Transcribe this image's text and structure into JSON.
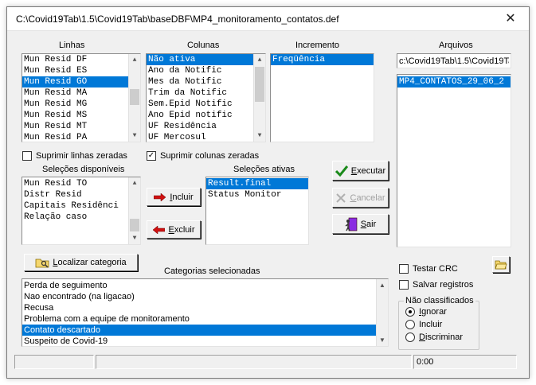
{
  "window": {
    "title": "C:\\Covid19Tab\\1.5\\Covid19Tab\\baseDBF\\MP4_monitoramento_contatos.def",
    "close_glyph": "✕"
  },
  "linhas": {
    "label": "Linhas",
    "items": [
      "Mun Resid DF",
      "Mun Resid ES",
      "Mun Resid GO",
      "Mun Resid MA",
      "Mun Resid MG",
      "Mun Resid MS",
      "Mun Resid MT",
      "Mun Resid PA"
    ],
    "selected_index": 2
  },
  "colunas": {
    "label": "Colunas",
    "items": [
      "Não ativa",
      "Ano da Notific",
      "Mes da Notific",
      "Trim da Notific",
      "Sem.Epid Notific",
      "Ano Epid notific",
      "UF Residência",
      "UF Mercosul"
    ],
    "selected_index": 0
  },
  "incremento": {
    "label": "Incremento",
    "items": [
      "Freqüência"
    ],
    "selected_index": 0
  },
  "arquivos": {
    "label": "Arquivos",
    "path_value": "c:\\Covid19Tab\\1.5\\Covid19Tab",
    "items": [
      "MP4_CONTATOS_29_06_2"
    ],
    "selected_index": 0
  },
  "checks": {
    "suprimir_linhas": {
      "label": "Suprimir linhas zeradas",
      "checked": false
    },
    "suprimir_colunas": {
      "label": "Suprimir colunas zeradas",
      "checked": true
    },
    "testar_crc": {
      "label": "Testar CRC",
      "checked": false
    },
    "salvar_registros": {
      "label": "Salvar registros",
      "checked": false
    }
  },
  "selecoes_disponiveis": {
    "label": "Seleções disponíveis",
    "items": [
      "Mun Resid TO",
      "Distr Resid",
      "Capitais Residênci",
      "Relação caso"
    ]
  },
  "selecoes_ativas": {
    "label": "Seleções ativas",
    "items": [
      "Result.final",
      "Status Monitor"
    ],
    "selected_index": 0
  },
  "buttons": {
    "incluir": {
      "first": "I",
      "rest": "ncluir"
    },
    "excluir": {
      "first": "E",
      "rest": "xcluir"
    },
    "executar": {
      "first": "E",
      "rest": "xecutar"
    },
    "cancelar": {
      "first": "C",
      "rest": "ancelar"
    },
    "sair": {
      "first": "S",
      "rest": "air"
    },
    "localizar": {
      "first": "L",
      "rest": "ocalizar categoria"
    }
  },
  "categorias": {
    "label": "Categorias selecionadas",
    "items": [
      "Perda de seguimento",
      "Nao encontrado (na ligacao)",
      "Recusa",
      "Problema com a equipe de monitoramento",
      "Contato descartado",
      "Suspeito de Covid-19"
    ],
    "selected_index": 4
  },
  "nao_classificados": {
    "label": "Não classificados",
    "options": [
      {
        "first": "I",
        "rest": "gnorar",
        "selected": true
      },
      {
        "first": "",
        "rest": "Incluir",
        "selected": false
      },
      {
        "first": "D",
        "rest": "iscriminar",
        "selected": false
      }
    ]
  },
  "statusbar": {
    "panel1": "",
    "panel2": "",
    "time": "0:00"
  },
  "colors": {
    "selection": "#0078d7",
    "dialog_bg": "#f0f0f0",
    "executar_check": "#1a8a1a",
    "arrow_red": "#d01010"
  }
}
